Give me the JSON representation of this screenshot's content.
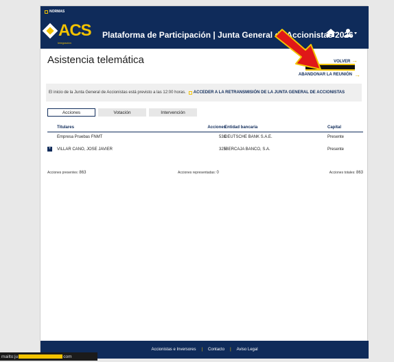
{
  "header": {
    "normas": "NORMAS",
    "logo": "ACS",
    "logo_sub": "Integración",
    "title": "Plataforma de Participación | Junta General de Accionistas 2026"
  },
  "page": {
    "title": "Asistencia telemática",
    "volver": "VOLVER",
    "abandonar": "ABANDONAR LA REUNIÓN"
  },
  "notice": {
    "text": "El inicio de la Junta General de Accionistas está previsto a las 12:00 horas.",
    "link": "ACCEDER A LA RETRANSMISIÓN DE LA JUNTA GENERAL DE ACCIONISTAS"
  },
  "tabs": [
    "Acciones",
    "Votación",
    "Intervención"
  ],
  "table": {
    "headers": {
      "titulares": "Titulares",
      "acciones": "Acciones",
      "entidad": "Entidad bancaria",
      "capital": "Capital"
    },
    "rows": [
      {
        "titular": "Empresa Pruebas FNMT",
        "acciones": "538",
        "entidad": "DEUTSCHE BANK S.A.E.",
        "capital": "Presente"
      },
      {
        "titular": "VILLAR CANO, JOSE JAVIER",
        "acciones": "325",
        "entidad": "IBERCAJA BANCO, S.A.",
        "capital": "Presente"
      }
    ]
  },
  "totals": {
    "presentes_label": "Acciones presentes:",
    "presentes_value": "863",
    "representadas_label": "Acciones representadas:",
    "representadas_value": "0",
    "totales_label": "Acciones totales:",
    "totales_value": "863"
  },
  "footer": {
    "links": [
      "Accionistas e Inversores",
      "Contacto",
      "Aviso Legal"
    ]
  },
  "statusbar": {
    "prefix": "mailto:ju",
    "suffix": "com"
  },
  "colors": {
    "brand": "#0f2b5a",
    "accent": "#f2c200",
    "annotation": "#e01818"
  }
}
